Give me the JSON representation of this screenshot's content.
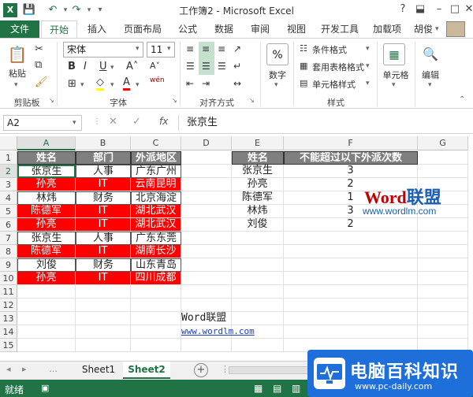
{
  "window": {
    "title": "工作簿2 - Microsoft Excel"
  },
  "ribbon_tabs": [
    "文件",
    "开始",
    "插入",
    "页面布局",
    "公式",
    "数据",
    "审阅",
    "视图",
    "开发工具",
    "加载项"
  ],
  "user": "胡俊",
  "ribbon": {
    "paste": "粘贴",
    "font_name": "宋体",
    "font_size": "11",
    "bold": "B",
    "italic": "I",
    "underline": "U",
    "wen": "wén",
    "number_label": "数字",
    "number_symbol": "%",
    "cond_format": "条件格式",
    "table_format": "套用表格格式",
    "cell_style": "单元格样式",
    "cells": "单元格",
    "edit": "编辑",
    "groups": {
      "clipboard": "剪贴板",
      "font": "字体",
      "align": "对齐方式",
      "styles": "样式"
    }
  },
  "formula": {
    "namebox": "A2",
    "fx": "fx",
    "value": "张京生"
  },
  "columns": [
    "A",
    "B",
    "C",
    "D",
    "E",
    "F",
    "G"
  ],
  "rows": [
    "1",
    "2",
    "3",
    "4",
    "5",
    "6",
    "7",
    "8",
    "9",
    "10",
    "11",
    "12",
    "13",
    "14",
    "15"
  ],
  "table1": {
    "headers": [
      "姓名",
      "部门",
      "外派地区"
    ],
    "rows": [
      {
        "name": "张京生",
        "dept": "人事",
        "area": "广东广州"
      },
      {
        "name": "孙亮",
        "dept": "IT",
        "area": "云南昆明"
      },
      {
        "name": "林炜",
        "dept": "财务",
        "area": "北京海淀"
      },
      {
        "name": "陈德军",
        "dept": "IT",
        "area": "湖北武汉"
      },
      {
        "name": "孙亮",
        "dept": "IT",
        "area": "湖北武汉"
      },
      {
        "name": "张京生",
        "dept": "人事",
        "area": "广东东莞"
      },
      {
        "name": "陈德军",
        "dept": "IT",
        "area": "湖南长沙"
      },
      {
        "name": "刘俊",
        "dept": "财务",
        "area": "山东青岛"
      },
      {
        "name": "孙亮",
        "dept": "IT",
        "area": "四川成都"
      }
    ]
  },
  "table2": {
    "headers": [
      "姓名",
      "不能超过以下外派次数"
    ],
    "rows": [
      {
        "name": "张京生",
        "count": "3"
      },
      {
        "name": "孙亮",
        "count": "2"
      },
      {
        "name": "陈德军",
        "count": "1"
      },
      {
        "name": "林炜",
        "count": "3"
      },
      {
        "name": "刘俊",
        "count": "2"
      }
    ]
  },
  "notes": {
    "d13": "Word联盟",
    "d14": "www.wordlm.com"
  },
  "watermark": {
    "word": "Word",
    "lianmeng": "联盟",
    "url": "www.wordlm.com"
  },
  "sheet_tabs": [
    "Sheet1",
    "Sheet2"
  ],
  "status": {
    "ready": "就绪"
  },
  "logo": {
    "main": "电脑百科知识",
    "url": "www.pc-daily.com"
  },
  "colors": {
    "accent": "#217346",
    "header_fill": "#7f7f7f",
    "red_fill": "#ff0000"
  }
}
